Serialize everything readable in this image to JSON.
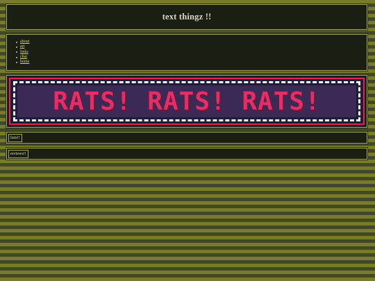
{
  "site": {
    "title": "text thingz !!"
  },
  "nav": {
    "items": [
      {
        "label": "about"
      },
      {
        "label": "art"
      },
      {
        "label": "links"
      },
      {
        "label": "chat"
      },
      {
        "label": "home"
      }
    ]
  },
  "banner": {
    "text": "RATS! RATS! RATS!"
  },
  "sections": {
    "lists_label": "lists!!",
    "reviews_label": "reviews!!"
  },
  "colors": {
    "stripe_light": "#7a7a2c",
    "stripe_dark": "#3f4a24",
    "panel_bg": "#1b1f13",
    "banner_text": "#e0306a",
    "banner_bg": "#3a2a55"
  }
}
